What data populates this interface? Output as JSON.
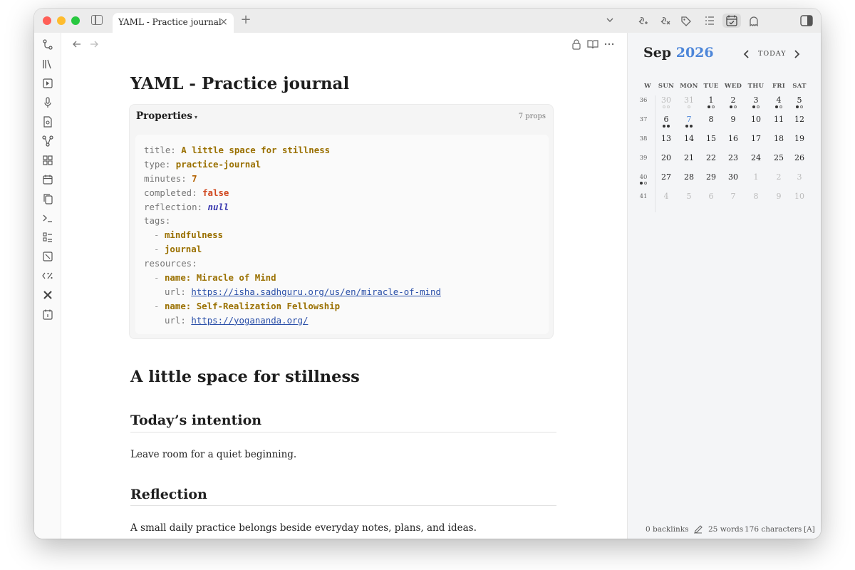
{
  "tab": {
    "title": "YAML - Practice journal",
    "close": "×",
    "new": "+"
  },
  "note": {
    "title": "YAML - Practice journal",
    "properties_label": "Properties",
    "properties_caret": "▾",
    "properties_count": "7 props",
    "yaml": {
      "title_key": "title:",
      "title_val": "A little space for stillness",
      "type_key": "type:",
      "type_val": "practice-journal",
      "minutes_key": "minutes:",
      "minutes_val": "7",
      "completed_key": "completed:",
      "completed_val": "false",
      "reflection_key": "reflection:",
      "reflection_val": "null",
      "tags_key": "tags:",
      "tags": [
        "mindfulness",
        "journal"
      ],
      "resources_key": "resources:",
      "resources": [
        {
          "name_line": "name: Miracle of Mind",
          "url_key": "url:",
          "url": "https://isha.sadhguru.org/us/en/miracle-of-mind"
        },
        {
          "name_line": "name: Self-Realization Fellowship",
          "url_key": "url:",
          "url": "https://yogananda.org/"
        }
      ],
      "dash": "-"
    },
    "heading": "A little space for stillness",
    "section1": {
      "title": "Today’s intention",
      "body": "Leave room for a quiet beginning."
    },
    "section2": {
      "title": "Reflection",
      "body": "A small daily practice belongs beside everyday notes, plans, and ideas."
    }
  },
  "calendar": {
    "month": "Sep",
    "year": "2026",
    "today_label": "TODAY",
    "headers": [
      "W",
      "SUN",
      "MON",
      "TUE",
      "WED",
      "THU",
      "FRI",
      "SAT"
    ],
    "weeks": [
      {
        "week": "36",
        "days": [
          "30",
          "31",
          "1",
          "2",
          "3",
          "4",
          "5"
        ]
      },
      {
        "week": "37",
        "days": [
          "6",
          "7",
          "8",
          "9",
          "10",
          "11",
          "12"
        ]
      },
      {
        "week": "38",
        "days": [
          "13",
          "14",
          "15",
          "16",
          "17",
          "18",
          "19"
        ]
      },
      {
        "week": "39",
        "days": [
          "20",
          "21",
          "22",
          "23",
          "24",
          "25",
          "26"
        ]
      },
      {
        "week": "40",
        "days": [
          "27",
          "28",
          "29",
          "30",
          "1",
          "2",
          "3"
        ]
      },
      {
        "week": "41",
        "days": [
          "4",
          "5",
          "6",
          "7",
          "8",
          "9",
          "10"
        ]
      }
    ],
    "colors": {
      "accent": "#4d86d9",
      "muted": "#bbbbbb"
    }
  },
  "status": {
    "backlinks": "0 backlinks",
    "words": "25 words",
    "characters": "176 characters",
    "mode": "[A]"
  },
  "icons": {
    "rail": [
      "git-branch-icon",
      "library-icon",
      "export-icon",
      "microphone-icon",
      "file-search-icon",
      "graph-icon",
      "grid-icon",
      "calendar-icon",
      "copy-icon",
      "terminal-icon",
      "checklist-icon",
      "diff-icon",
      "percent-code-icon",
      "tools-icon",
      "daily-note-icon"
    ],
    "toolbar": [
      "link-add-icon",
      "unlink-icon",
      "tag-icon",
      "outline-icon",
      "calendar-check-icon",
      "ghost-icon",
      "right-sidebar-icon"
    ]
  }
}
